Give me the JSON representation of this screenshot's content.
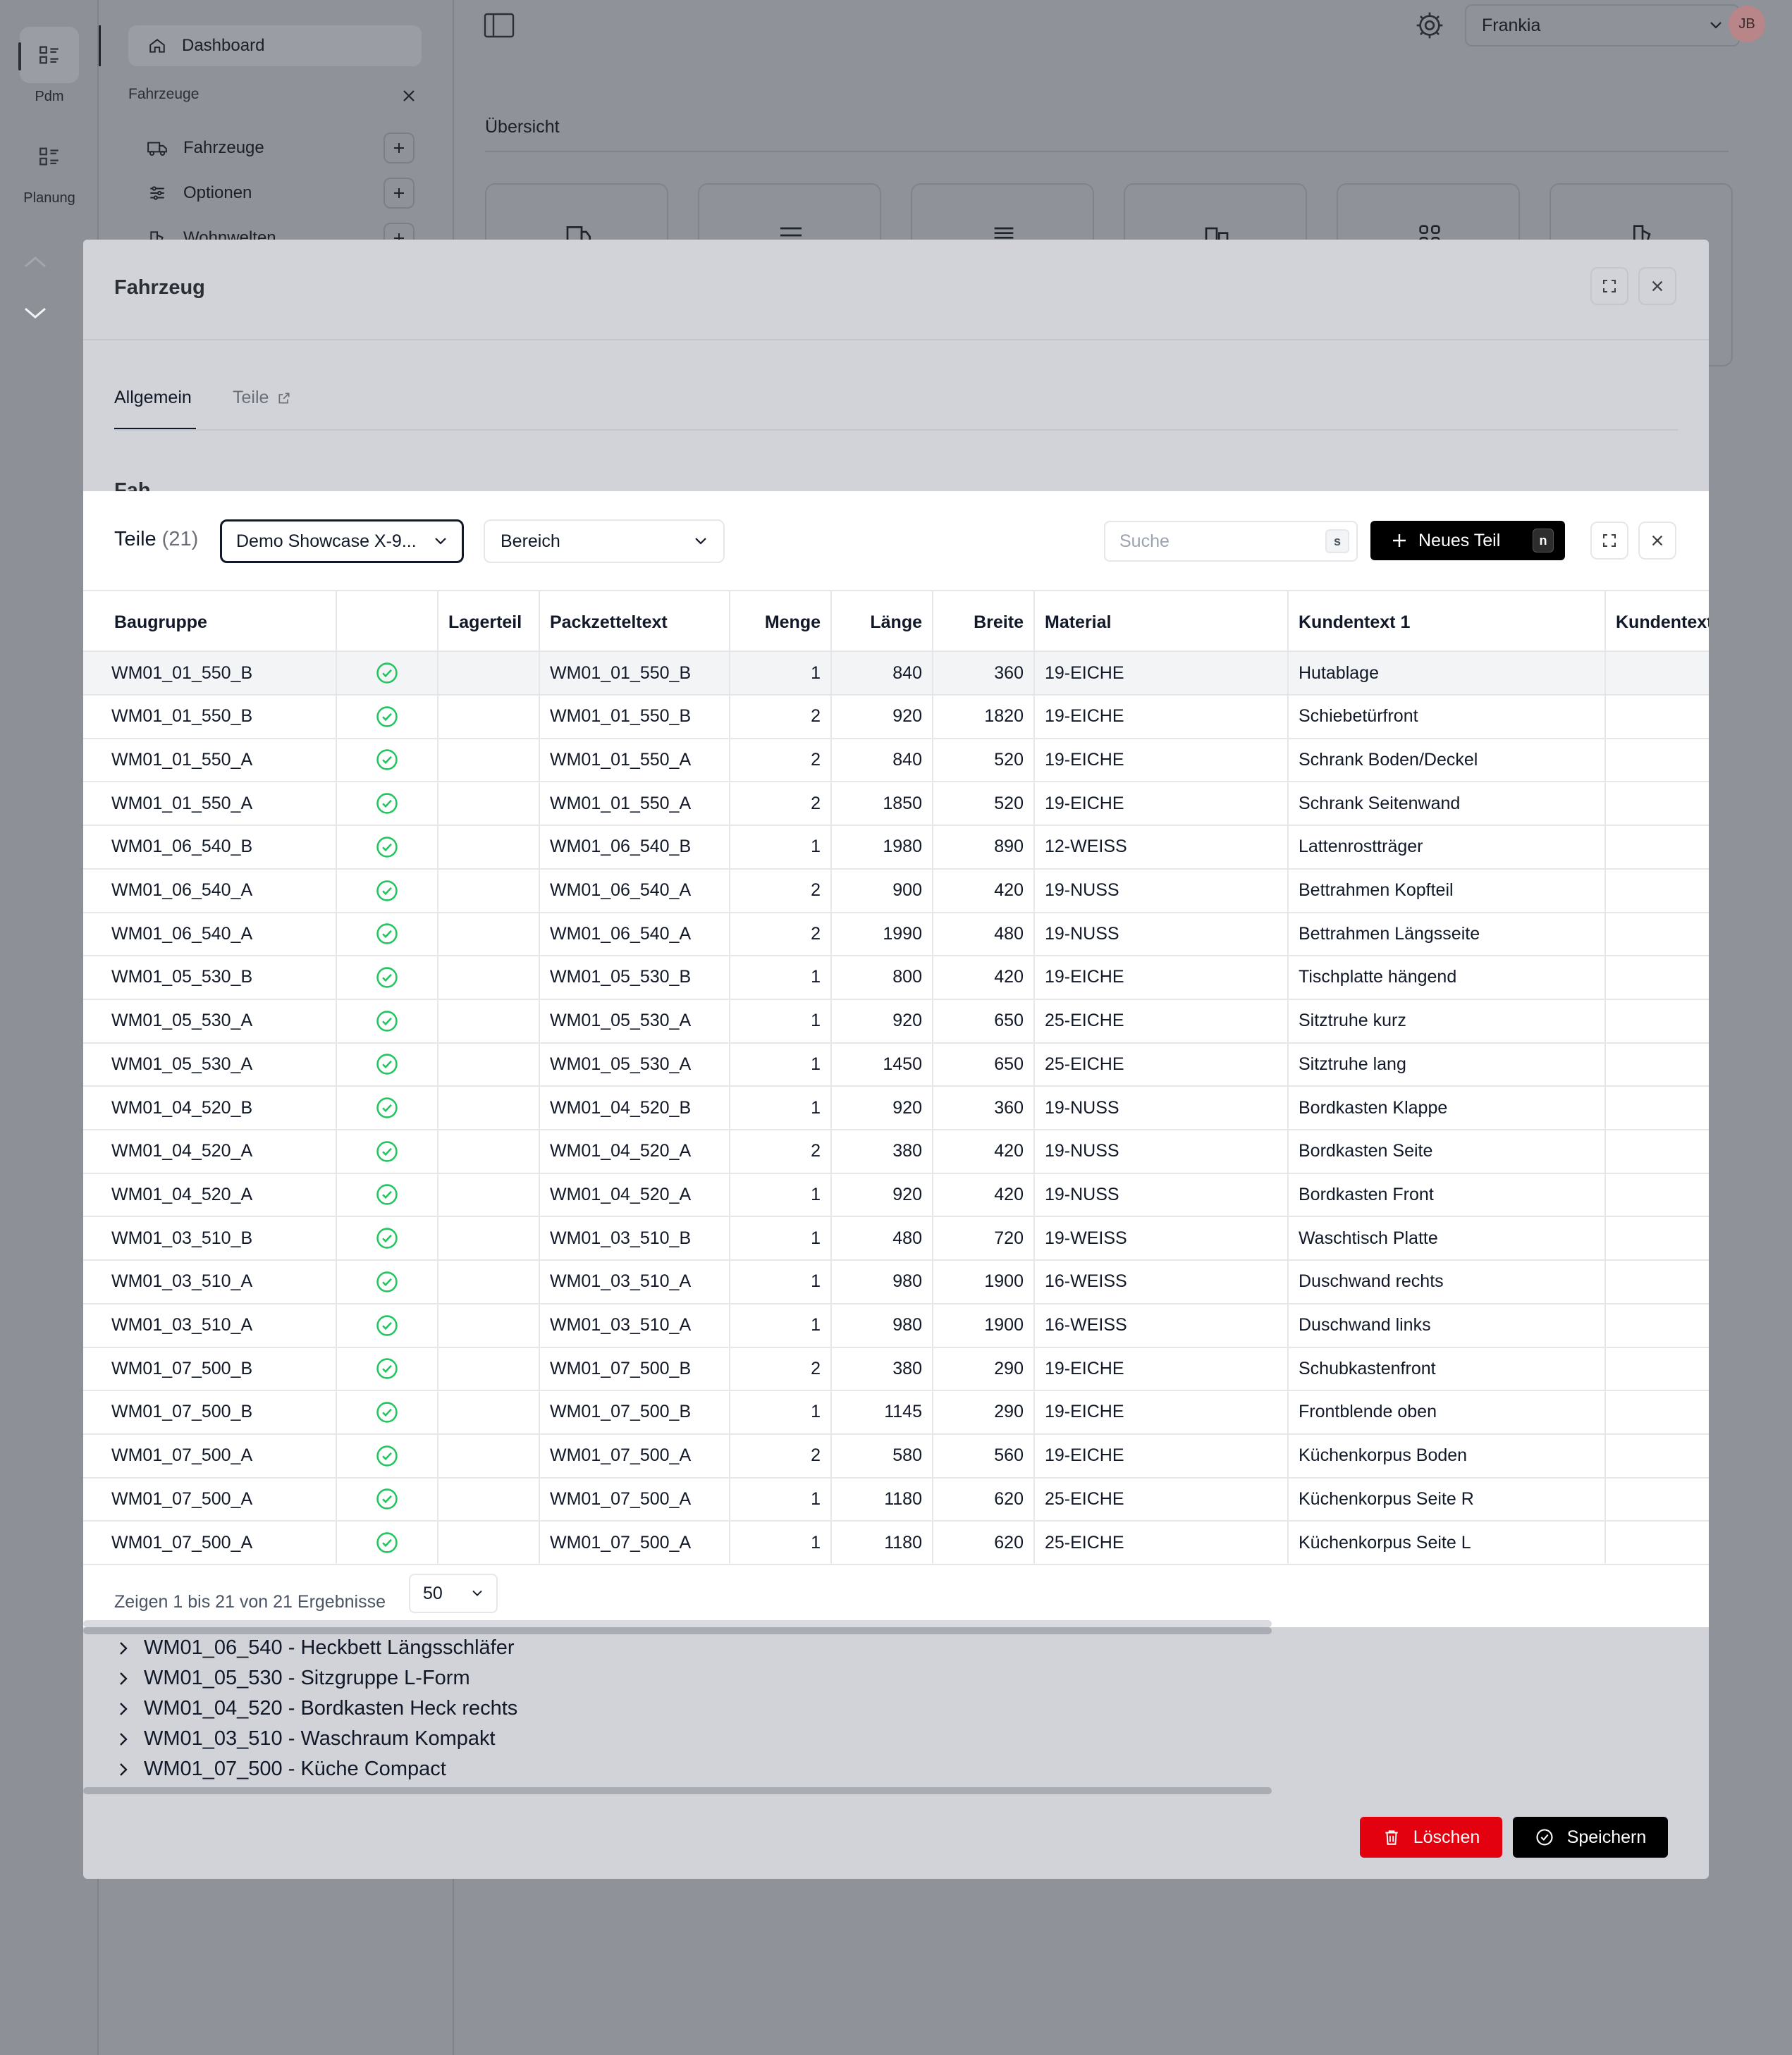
{
  "app": {
    "rail": [
      {
        "label": "Pdm",
        "icon": "list-icon"
      },
      {
        "label": "Planung",
        "icon": "list-icon"
      }
    ],
    "nav": {
      "dashboard": "Dashboard",
      "section_title": "Fahrzeuge",
      "items": [
        {
          "label": "Fahrzeuge",
          "icon": "truck-icon"
        },
        {
          "label": "Optionen",
          "icon": "sliders-icon"
        },
        {
          "label": "Wohnwelten",
          "icon": "layers-icon"
        }
      ]
    },
    "topbar": {
      "manufacturer": "Frankia",
      "user_initials": "JB"
    },
    "overview_title": "Übersicht"
  },
  "vehicle_modal": {
    "title": "Fahrzeug",
    "tabs": [
      "Allgemein",
      "Teile"
    ],
    "active_tab": "Allgemein",
    "section_heading_partial": "Fah",
    "groups": [
      "WM01_06_540 - Heckbett Längsschläfer",
      "WM01_05_530 - Sitzgruppe L-Form",
      "WM01_04_520 - Bordkasten Heck rechts",
      "WM01_03_510 - Waschraum Kompakt",
      "WM01_07_500 - Küche Compact"
    ],
    "delete_label": "Löschen",
    "save_label": "Speichern",
    "colors": {
      "danger": "#e3000f",
      "primary": "#000000"
    }
  },
  "parts_modal": {
    "title": "Teile",
    "count": "(21)",
    "vehicle_select": "Demo Showcase X-9...",
    "area_select": "Bereich",
    "search_placeholder": "Suche",
    "search_shortcut": "s",
    "new_part_label": "Neues Teil",
    "new_part_shortcut": "n",
    "columns": [
      "Baugruppe",
      "",
      "Lagerteil",
      "Packzetteltext",
      "Menge",
      "Länge",
      "Breite",
      "Material",
      "Kundentext 1",
      "Kundentext"
    ],
    "rows": [
      {
        "baugruppe": "WM01_01_550_B",
        "packzettel": "WM01_01_550_B",
        "menge": "1",
        "laenge": "840",
        "breite": "360",
        "material": "19-EICHE",
        "kundentext": "Hutablage"
      },
      {
        "baugruppe": "WM01_01_550_B",
        "packzettel": "WM01_01_550_B",
        "menge": "2",
        "laenge": "920",
        "breite": "1820",
        "material": "19-EICHE",
        "kundentext": "Schiebetürfront"
      },
      {
        "baugruppe": "WM01_01_550_A",
        "packzettel": "WM01_01_550_A",
        "menge": "2",
        "laenge": "840",
        "breite": "520",
        "material": "19-EICHE",
        "kundentext": "Schrank Boden/Deckel"
      },
      {
        "baugruppe": "WM01_01_550_A",
        "packzettel": "WM01_01_550_A",
        "menge": "2",
        "laenge": "1850",
        "breite": "520",
        "material": "19-EICHE",
        "kundentext": "Schrank Seitenwand"
      },
      {
        "baugruppe": "WM01_06_540_B",
        "packzettel": "WM01_06_540_B",
        "menge": "1",
        "laenge": "1980",
        "breite": "890",
        "material": "12-WEISS",
        "kundentext": "Lattenrostträger"
      },
      {
        "baugruppe": "WM01_06_540_A",
        "packzettel": "WM01_06_540_A",
        "menge": "2",
        "laenge": "900",
        "breite": "420",
        "material": "19-NUSS",
        "kundentext": "Bettrahmen Kopfteil"
      },
      {
        "baugruppe": "WM01_06_540_A",
        "packzettel": "WM01_06_540_A",
        "menge": "2",
        "laenge": "1990",
        "breite": "480",
        "material": "19-NUSS",
        "kundentext": "Bettrahmen Längsseite"
      },
      {
        "baugruppe": "WM01_05_530_B",
        "packzettel": "WM01_05_530_B",
        "menge": "1",
        "laenge": "800",
        "breite": "420",
        "material": "19-EICHE",
        "kundentext": "Tischplatte hängend"
      },
      {
        "baugruppe": "WM01_05_530_A",
        "packzettel": "WM01_05_530_A",
        "menge": "1",
        "laenge": "920",
        "breite": "650",
        "material": "25-EICHE",
        "kundentext": "Sitztruhe kurz"
      },
      {
        "baugruppe": "WM01_05_530_A",
        "packzettel": "WM01_05_530_A",
        "menge": "1",
        "laenge": "1450",
        "breite": "650",
        "material": "25-EICHE",
        "kundentext": "Sitztruhe lang"
      },
      {
        "baugruppe": "WM01_04_520_B",
        "packzettel": "WM01_04_520_B",
        "menge": "1",
        "laenge": "920",
        "breite": "360",
        "material": "19-NUSS",
        "kundentext": "Bordkasten Klappe"
      },
      {
        "baugruppe": "WM01_04_520_A",
        "packzettel": "WM01_04_520_A",
        "menge": "2",
        "laenge": "380",
        "breite": "420",
        "material": "19-NUSS",
        "kundentext": "Bordkasten Seite"
      },
      {
        "baugruppe": "WM01_04_520_A",
        "packzettel": "WM01_04_520_A",
        "menge": "1",
        "laenge": "920",
        "breite": "420",
        "material": "19-NUSS",
        "kundentext": "Bordkasten Front"
      },
      {
        "baugruppe": "WM01_03_510_B",
        "packzettel": "WM01_03_510_B",
        "menge": "1",
        "laenge": "480",
        "breite": "720",
        "material": "19-WEISS",
        "kundentext": "Waschtisch Platte"
      },
      {
        "baugruppe": "WM01_03_510_A",
        "packzettel": "WM01_03_510_A",
        "menge": "1",
        "laenge": "980",
        "breite": "1900",
        "material": "16-WEISS",
        "kundentext": "Duschwand rechts"
      },
      {
        "baugruppe": "WM01_03_510_A",
        "packzettel": "WM01_03_510_A",
        "menge": "1",
        "laenge": "980",
        "breite": "1900",
        "material": "16-WEISS",
        "kundentext": "Duschwand links"
      },
      {
        "baugruppe": "WM01_07_500_B",
        "packzettel": "WM01_07_500_B",
        "menge": "2",
        "laenge": "380",
        "breite": "290",
        "material": "19-EICHE",
        "kundentext": "Schubkastenfront"
      },
      {
        "baugruppe": "WM01_07_500_B",
        "packzettel": "WM01_07_500_B",
        "menge": "1",
        "laenge": "1145",
        "breite": "290",
        "material": "19-EICHE",
        "kundentext": "Frontblende oben"
      },
      {
        "baugruppe": "WM01_07_500_A",
        "packzettel": "WM01_07_500_A",
        "menge": "2",
        "laenge": "580",
        "breite": "560",
        "material": "19-EICHE",
        "kundentext": "Küchenkorpus Boden"
      },
      {
        "baugruppe": "WM01_07_500_A",
        "packzettel": "WM01_07_500_A",
        "menge": "1",
        "laenge": "1180",
        "breite": "620",
        "material": "25-EICHE",
        "kundentext": "Küchenkorpus Seite R"
      },
      {
        "baugruppe": "WM01_07_500_A",
        "packzettel": "WM01_07_500_A",
        "menge": "1",
        "laenge": "1180",
        "breite": "620",
        "material": "25-EICHE",
        "kundentext": "Küchenkorpus Seite L"
      }
    ],
    "footer_text": "Zeigen 1 bis 21 von 21 Ergebnisse",
    "page_size": "50",
    "colors": {
      "check": "#22c55e"
    }
  }
}
